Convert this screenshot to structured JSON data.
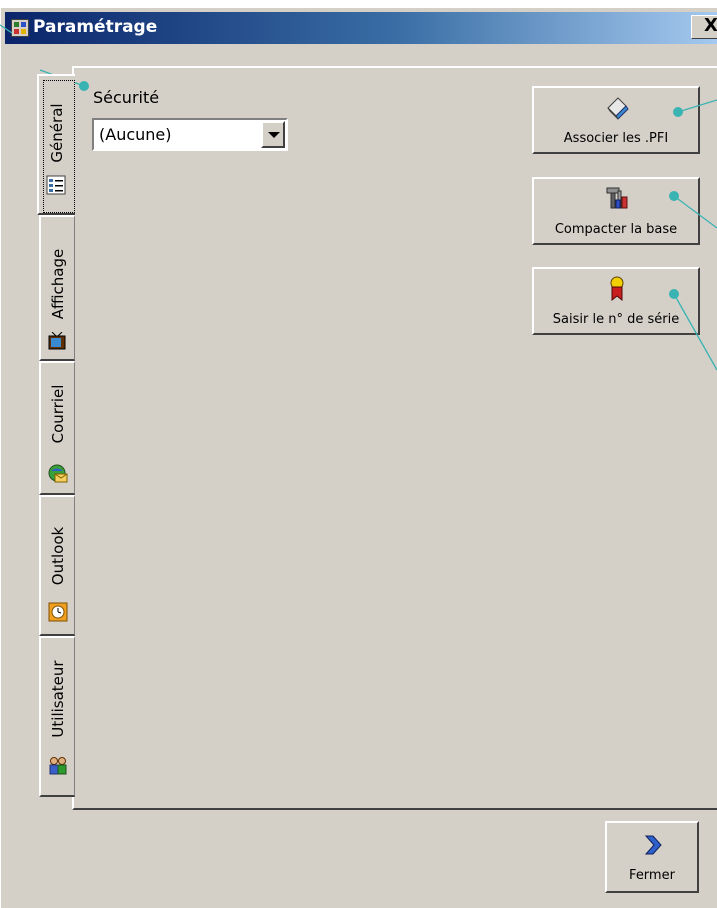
{
  "window": {
    "title": "Paramétrage",
    "close_label": "X"
  },
  "tabs": [
    {
      "label": "Général",
      "icon": "settings-list-icon",
      "active": true
    },
    {
      "label": "Affichage",
      "icon": "tv-icon",
      "active": false
    },
    {
      "label": "Courriel",
      "icon": "email-globe-icon",
      "active": false
    },
    {
      "label": "Outlook",
      "icon": "clock-icon",
      "active": false
    },
    {
      "label": "Utilisateur",
      "icon": "users-icon",
      "active": false
    }
  ],
  "general": {
    "security_label": "Sécurité",
    "security_value": "(Aucune)"
  },
  "buttons": {
    "associate": "Associer les .PFI",
    "compact": "Compacter la base",
    "serial": "Saisir le n° de série",
    "close": "Fermer"
  },
  "colors": {
    "callout": "#3ab3b3",
    "titlebar_start": "#0a246a",
    "titlebar_end": "#a6caf0"
  }
}
